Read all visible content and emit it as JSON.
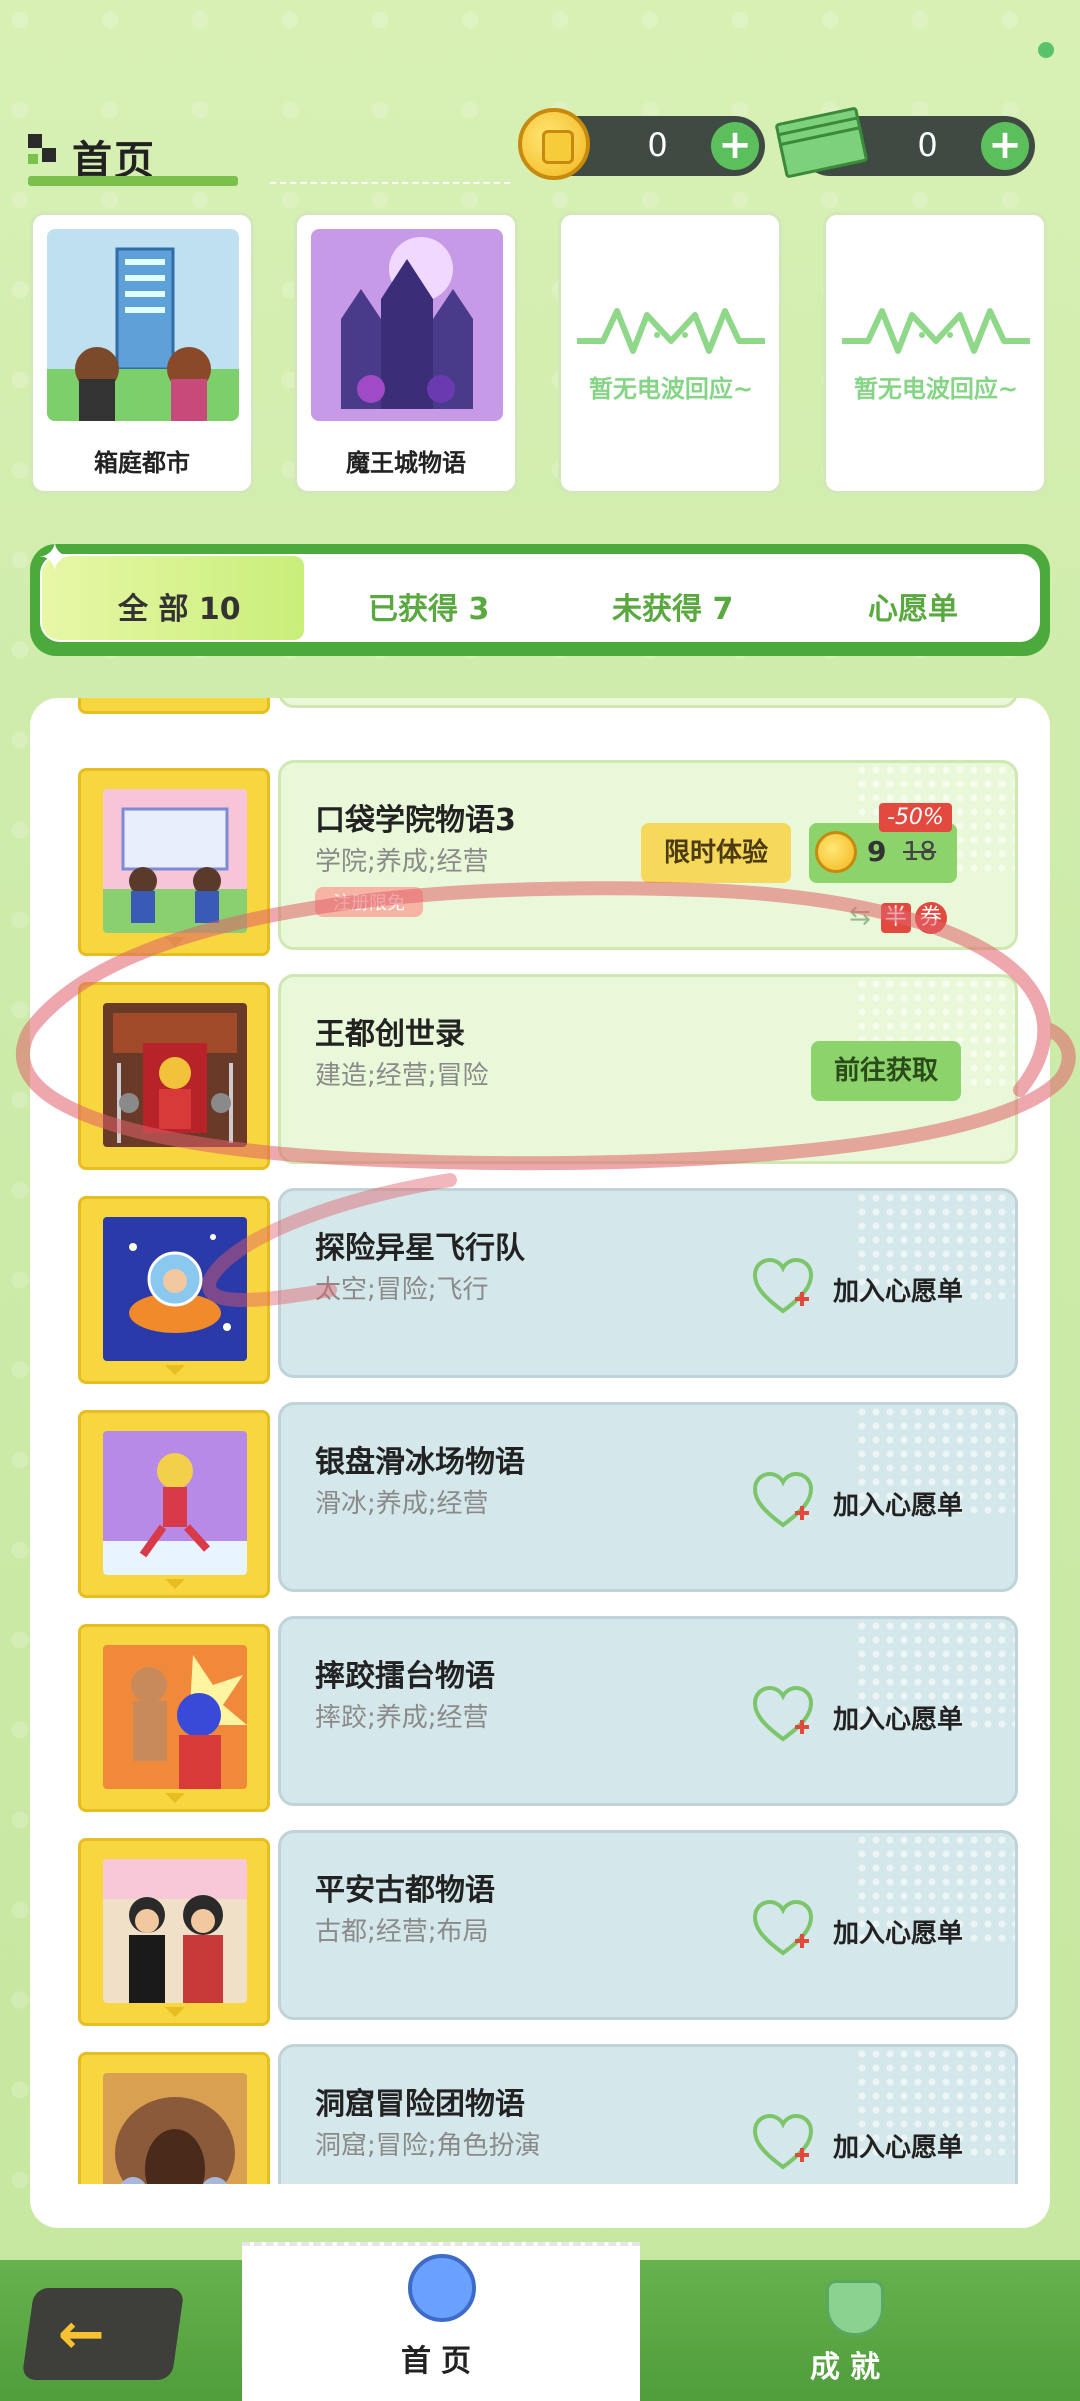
{
  "header": {
    "title": "首页"
  },
  "currency": {
    "coins": "0",
    "cash": "0"
  },
  "featured_games": [
    {
      "name": "箱庭都市"
    },
    {
      "name": "魔王城物语"
    },
    {
      "empty_text": "暂无电波回应~"
    },
    {
      "empty_text": "暂无电波回应~"
    }
  ],
  "tabs": [
    {
      "label": "全 部 10",
      "active": true
    },
    {
      "label": "已获得 3",
      "active": false
    },
    {
      "label": "未获得 7",
      "active": false
    },
    {
      "label": "心愿单",
      "active": false
    }
  ],
  "games": [
    {
      "title": "口袋学院物语3",
      "tags": "学院;养成;经营",
      "badge": "注册限免",
      "trial_label": "限时体验",
      "price_now": "9",
      "price_old": "18",
      "discount": "-50%",
      "half": "半",
      "coupon": "券",
      "state": "sale"
    },
    {
      "title": "王都创世录",
      "tags": "建造;经营;冒险",
      "action_label": "前往获取",
      "state": "owned"
    },
    {
      "title": "探险异星飞行队",
      "tags": "太空;冒险;飞行",
      "wish_label": "加入心愿单",
      "state": "unowned"
    },
    {
      "title": "银盘滑冰场物语",
      "tags": "滑冰;养成;经营",
      "wish_label": "加入心愿单",
      "state": "unowned"
    },
    {
      "title": "摔跤擂台物语",
      "tags": "摔跤;养成;经营",
      "wish_label": "加入心愿单",
      "state": "unowned"
    },
    {
      "title": "平安古都物语",
      "tags": "古都;经营;布局",
      "wish_label": "加入心愿单",
      "state": "unowned"
    },
    {
      "title": "洞窟冒险团物语",
      "tags": "洞窟;冒险;角色扮演",
      "wish_label": "加入心愿单",
      "state": "unowned"
    }
  ],
  "bottom_nav": {
    "home_label": "首页",
    "achievements_label": "成就"
  },
  "colors": {
    "accent_green": "#4caa3c",
    "owned_bg": "#e9f8d8",
    "unowned_bg": "#d4e7ea",
    "cartridge": "#f7d63f",
    "annotation_red": "#e0606a"
  }
}
